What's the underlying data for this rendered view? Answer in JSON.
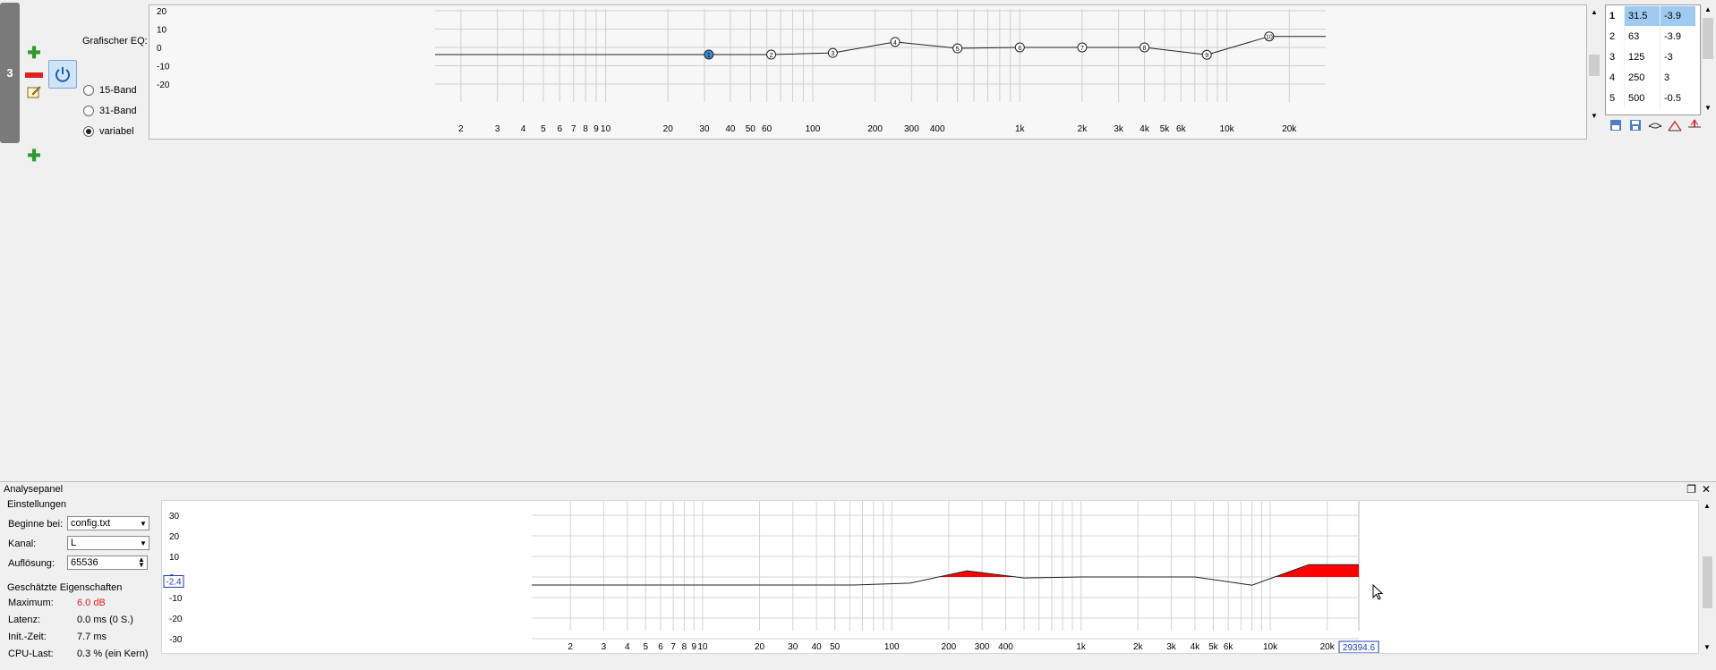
{
  "filter": {
    "index": "3",
    "title": "Grafischer EQ:",
    "modes": [
      "15-Band",
      "31-Band",
      "variabel"
    ],
    "selected_mode": "variabel",
    "y_ticks": [
      "20",
      "10",
      "0",
      "-10",
      "-20"
    ],
    "x_ticks": [
      "2",
      "3",
      "4",
      "5",
      "6",
      "7",
      "8",
      "9",
      "10",
      "20",
      "30",
      "40",
      "50",
      "60",
      "100",
      "200",
      "300",
      "400",
      "1k",
      "2k",
      "3k",
      "4k",
      "5k",
      "6k",
      "10k",
      "20k"
    ],
    "bands": [
      {
        "num": "1",
        "freq": "31.5",
        "gain": "-3.9"
      },
      {
        "num": "2",
        "freq": "63",
        "gain": "-3.9"
      },
      {
        "num": "3",
        "freq": "125",
        "gain": "-3"
      },
      {
        "num": "4",
        "freq": "250",
        "gain": "3"
      },
      {
        "num": "5",
        "freq": "500",
        "gain": "-0.5"
      },
      {
        "num": "6",
        "freq": "1000",
        "gain": "0"
      },
      {
        "num": "7",
        "freq": "2000",
        "gain": "0"
      },
      {
        "num": "8",
        "freq": "4000",
        "gain": "0"
      },
      {
        "num": "9",
        "freq": "8000",
        "gain": "-4"
      },
      {
        "num": "10",
        "freq": "16000",
        "gain": "6"
      }
    ],
    "visible_rows": 5
  },
  "analysis": {
    "title": "Analysepanel",
    "settings_title": "Einstellungen",
    "begin_label": "Beginne bei:",
    "begin_value": "config.txt",
    "channel_label": "Kanal:",
    "channel_value": "L",
    "resolution_label": "Auflösung:",
    "resolution_value": "65536",
    "props_title": "Geschätzte Eigenschaften",
    "props": [
      {
        "label": "Maximum:",
        "value": "6.0 dB",
        "color": "#e02020"
      },
      {
        "label": "Latenz:",
        "value": "0.0 ms (0 S.)",
        "color": "#000000"
      },
      {
        "label": "Init.-Zeit:",
        "value": "7.7 ms",
        "color": "#000000"
      },
      {
        "label": "CPU-Last:",
        "value": "0.3 % (ein Kern)",
        "color": "#000000"
      }
    ],
    "y_ticks": [
      "30",
      "20",
      "10",
      "0",
      "-10",
      "-20",
      "-30"
    ],
    "x_ticks": [
      "2",
      "3",
      "4",
      "5",
      "6",
      "7",
      "8",
      "9",
      "10",
      "20",
      "30",
      "40",
      "50",
      "100",
      "200",
      "300",
      "400",
      "1k",
      "2k",
      "3k",
      "4k",
      "5k",
      "6k",
      "10k",
      "20k"
    ],
    "cursor_y": "-2.4",
    "cursor_x": "29394.6"
  },
  "colors": {
    "fill": "#ff0000",
    "accent": "#9fcaf2",
    "grid": "#dcdcdc"
  }
}
